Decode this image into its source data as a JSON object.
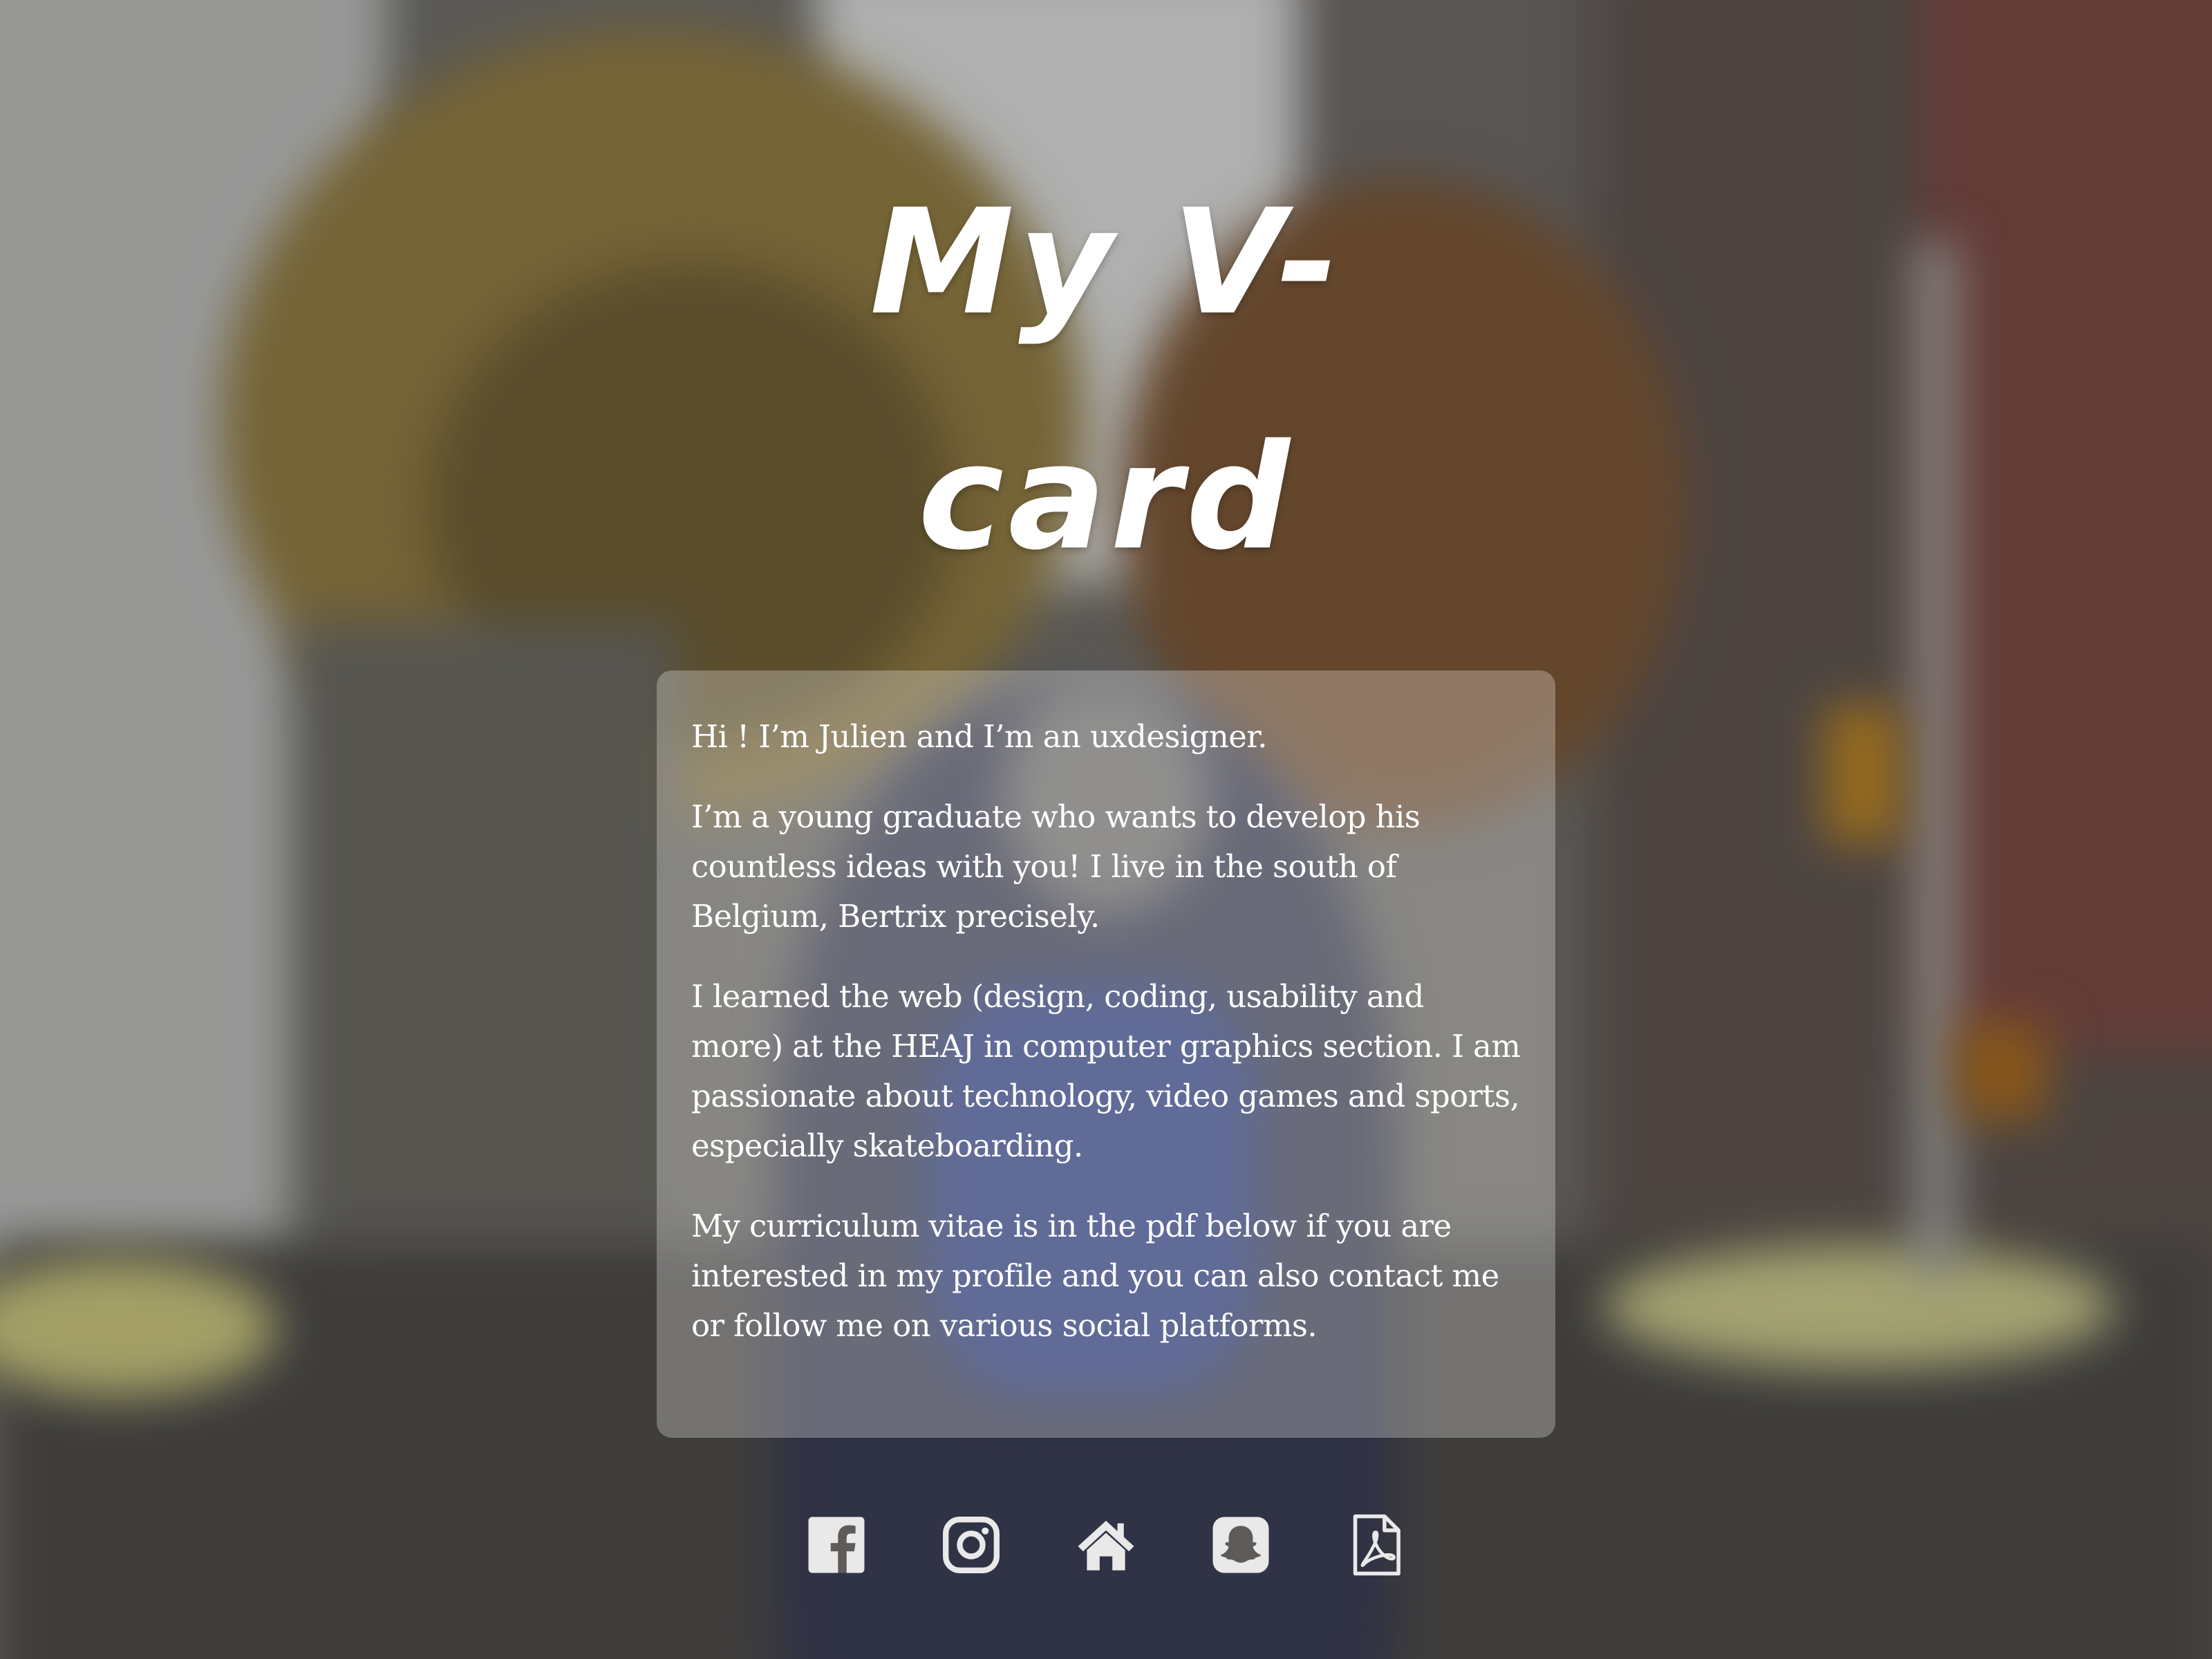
{
  "page": {
    "title": "My V-card"
  },
  "intro": {
    "paragraphs": [
      "Hi ! I’m Julien and I’m an uxdesigner.",
      "I’m a young graduate who wants to develop his countless ideas with you! I live in the south of Belgium, Bertrix precisely.",
      "I learned the web (design, coding, usability and more) at the HEAJ in computer graphics section. I am passionate about technology, video games and sports, especially skateboarding.",
      "My curriculum vitae is in the pdf below if you are interested in my profile and you can also contact me or follow me on various social platforms."
    ]
  },
  "social_links": [
    {
      "icon": "facebook-icon"
    },
    {
      "icon": "instagram-icon"
    },
    {
      "icon": "home-icon"
    },
    {
      "icon": "snapchat-icon"
    },
    {
      "icon": "pdf-icon"
    }
  ],
  "colors": {
    "text": "#ffffff",
    "card_background": "rgba(255,255,255,0.28)",
    "icon": "#e9e9e9"
  }
}
